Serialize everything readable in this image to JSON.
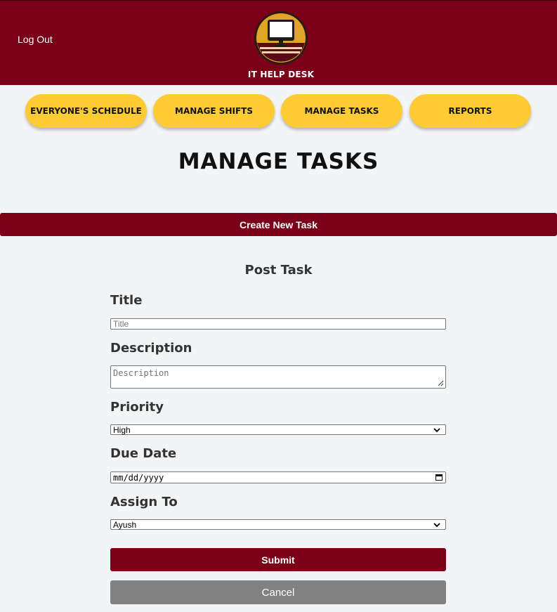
{
  "header": {
    "logout_label": "Log Out",
    "brand_text": "IT HELP DESK",
    "logo_icon": "computer-monitor-icon",
    "colors": {
      "maroon": "#7a0019",
      "gold": "#ffcb34"
    }
  },
  "nav": {
    "items": [
      {
        "label": "EVERYONE'S SCHEDULE"
      },
      {
        "label": "MANAGE SHIFTS"
      },
      {
        "label": "MANAGE TASKS"
      },
      {
        "label": "REPORTS"
      }
    ]
  },
  "page": {
    "title": "MANAGE TASKS",
    "create_label": "Create New Task"
  },
  "form": {
    "heading": "Post Task",
    "title_label": "Title",
    "title_placeholder": "Title",
    "description_label": "Description",
    "description_placeholder": "Description",
    "priority_label": "Priority",
    "priority_value": "High",
    "due_date_label": "Due Date",
    "due_date_placeholder": "mm/dd/yyyy",
    "assign_label": "Assign To",
    "assign_value": "Ayush",
    "submit_label": "Submit",
    "cancel_label": "Cancel"
  }
}
